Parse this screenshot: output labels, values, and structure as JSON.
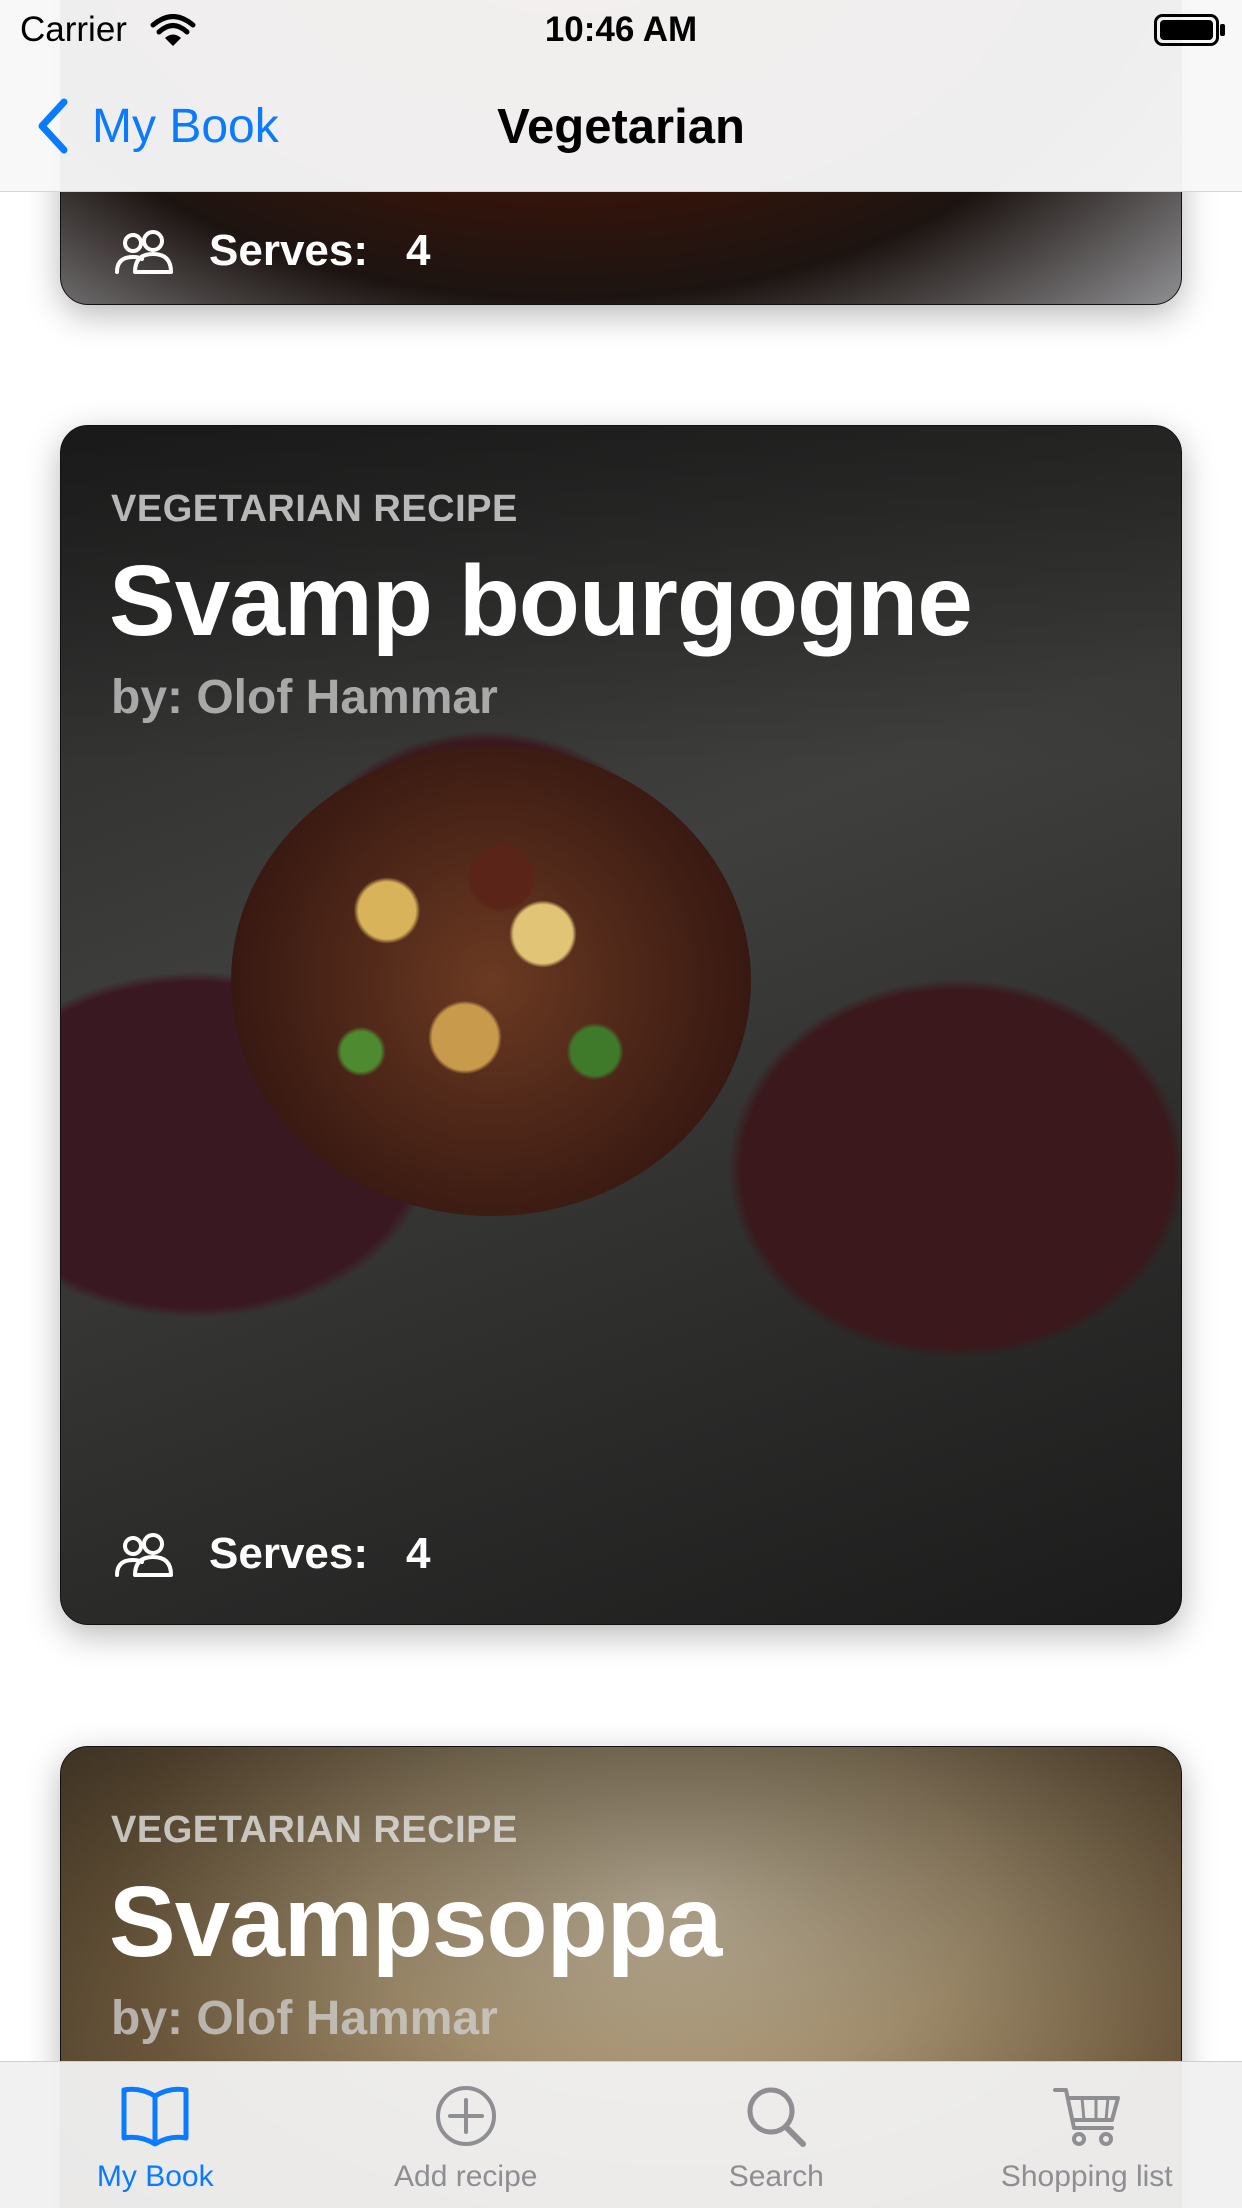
{
  "status_bar": {
    "carrier": "Carrier",
    "time": "10:46 AM"
  },
  "nav": {
    "back_label": "My Book",
    "title": "Vegetarian"
  },
  "cards": [
    {
      "category": "",
      "title": "",
      "author": "",
      "serves_label": "Serves:",
      "serves_count": "4"
    },
    {
      "category": "VEGETARIAN RECIPE",
      "title": "Svamp bourgogne",
      "author": "by: Olof Hammar",
      "serves_label": "Serves:",
      "serves_count": "4"
    },
    {
      "category": "VEGETARIAN RECIPE",
      "title": "Svampsoppa",
      "author": "by: Olof Hammar"
    }
  ],
  "tab_bar": {
    "tabs": [
      {
        "label": "My Book",
        "icon": "book-icon",
        "active": true
      },
      {
        "label": "Add recipe",
        "icon": "plus-circle-icon",
        "active": false
      },
      {
        "label": "Search",
        "icon": "search-icon",
        "active": false
      },
      {
        "label": "Shopping list",
        "icon": "cart-icon",
        "active": false
      }
    ]
  },
  "colors": {
    "accent": "#0a7aff",
    "tab_inactive": "#8e8e93"
  }
}
